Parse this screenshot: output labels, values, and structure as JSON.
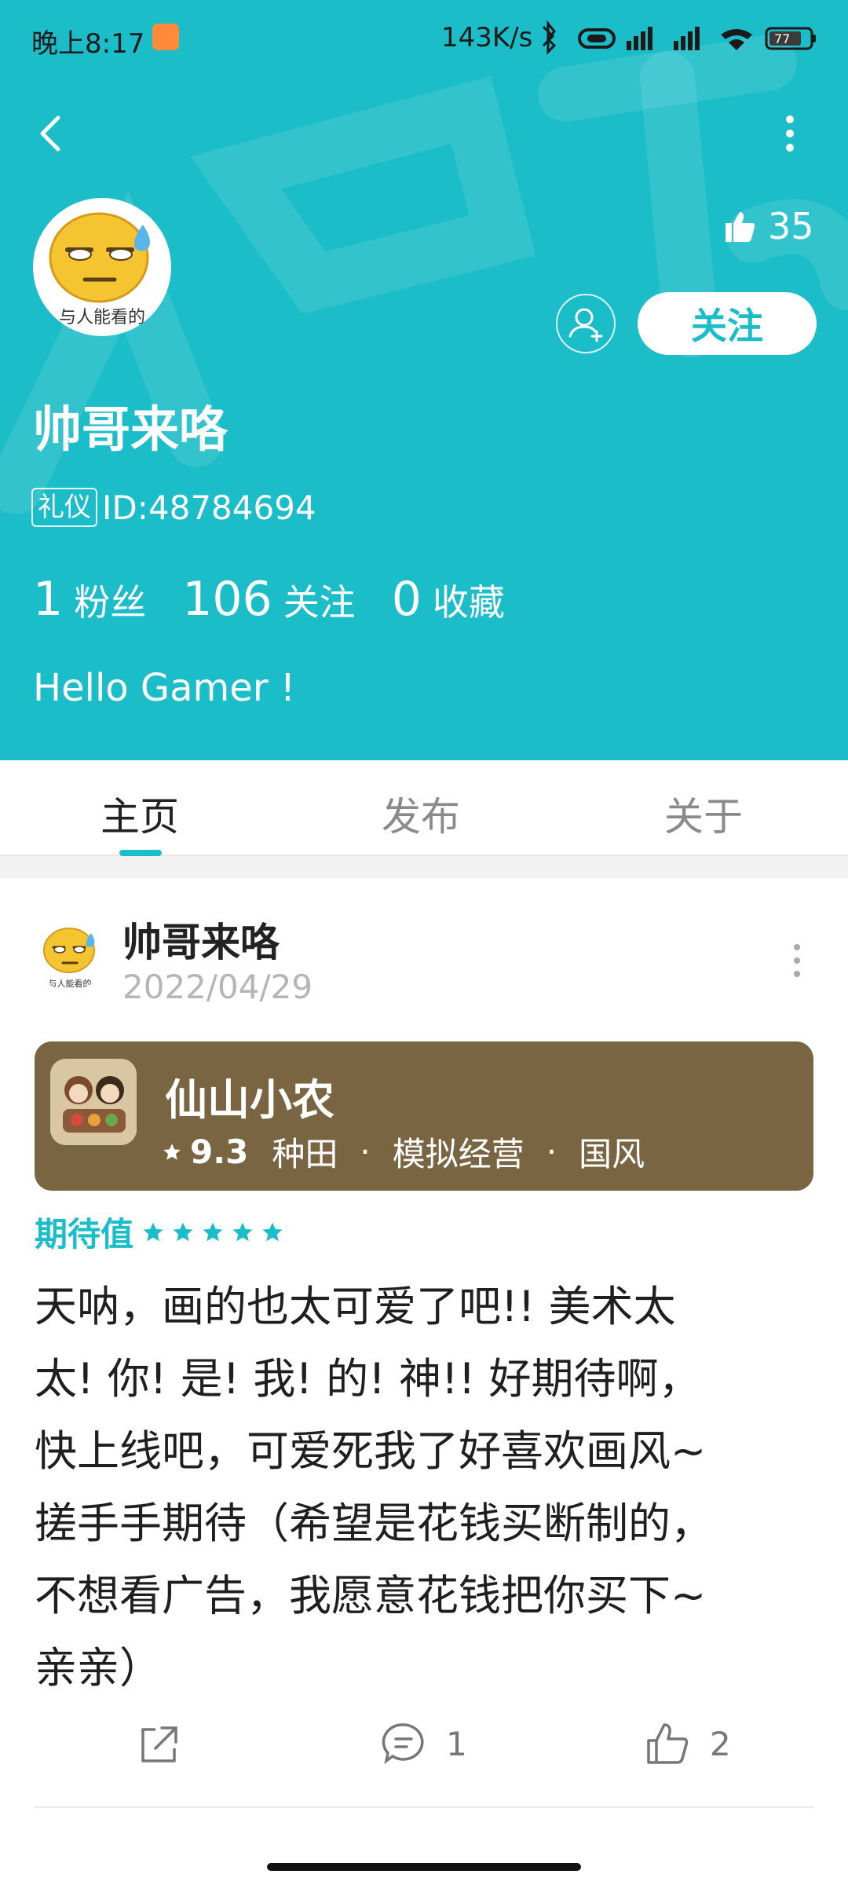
{
  "status_bar": {
    "time": "晚上8:17",
    "network_speed": "143K/s",
    "battery": "77"
  },
  "profile": {
    "likes_count": "35",
    "follow_label": "关注",
    "username": "帅哥来咯",
    "badge": "礼仪",
    "id_text": "ID:48784694",
    "avatar_caption": "与人能看的",
    "stats": [
      {
        "value": "1",
        "label": "粉丝"
      },
      {
        "value": "106",
        "label": "关注"
      },
      {
        "value": "0",
        "label": "收藏"
      }
    ],
    "bio": "Hello Gamer !"
  },
  "tabs": [
    {
      "label": "主页",
      "active": true
    },
    {
      "label": "发布",
      "active": false
    },
    {
      "label": "关于",
      "active": false
    }
  ],
  "post": {
    "author": "帅哥来咯",
    "date": "2022/04/29",
    "avatar_caption": "与人能看的",
    "game": {
      "name": "仙山小农",
      "rating": "9.3",
      "tags": [
        "种田",
        "模拟经营",
        "国风"
      ]
    },
    "expect_label": "期待值",
    "expect_stars": 5,
    "lines": [
      "天呐，画的也太可爱了吧!! 美术太",
      "太! 你! 是! 我! 的! 神!! 好期待啊，",
      "快上线吧，可爱死我了好喜欢画风~",
      "搓手手期待（希望是花钱买断制的，",
      "不想看广告，我愿意花钱把你买下~",
      "亲亲）"
    ],
    "comment_count": "1",
    "like_count": "2"
  },
  "colors": {
    "accent": "#1bbdc8",
    "game_card": "#7a6543"
  }
}
